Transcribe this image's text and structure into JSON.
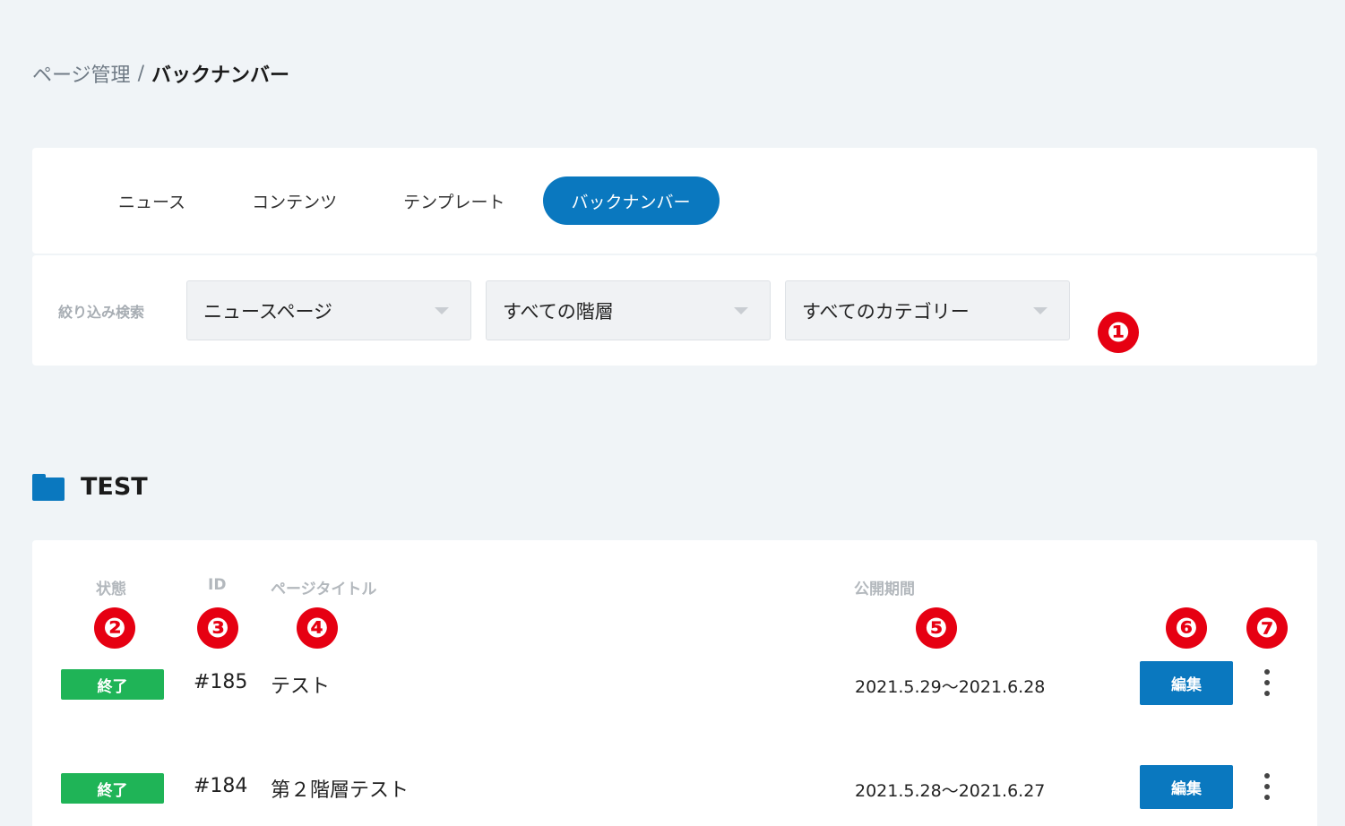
{
  "breadcrumb": {
    "parent": "ページ管理",
    "separator": "/",
    "current": "バックナンバー"
  },
  "tabs": [
    {
      "label": "ニュース",
      "active": false
    },
    {
      "label": "コンテンツ",
      "active": false
    },
    {
      "label": "テンプレート",
      "active": false
    },
    {
      "label": "バックナンバー",
      "active": true
    }
  ],
  "filter": {
    "label": "絞り込み検索",
    "selects": [
      {
        "value": "ニュースページ"
      },
      {
        "value": "すべての階層"
      },
      {
        "value": "すべてのカテゴリー"
      }
    ]
  },
  "markers": [
    "❶",
    "❷",
    "❸",
    "❹",
    "❺",
    "❻",
    "❼"
  ],
  "section": {
    "title": "TEST",
    "icon": "folder-icon"
  },
  "table": {
    "headers": {
      "status": "状態",
      "id": "ID",
      "title": "ページタイトル",
      "period": "公開期間"
    },
    "rows": [
      {
        "status": "終了",
        "id": "#185",
        "title": "テスト",
        "period": "2021.5.29～2021.6.28",
        "edit": "編集"
      },
      {
        "status": "終了",
        "id": "#184",
        "title": "第２階層テスト",
        "period": "2021.5.28～2021.6.27",
        "edit": "編集"
      }
    ]
  },
  "colors": {
    "accent": "#0a78bf",
    "status_done": "#1fb457",
    "marker": "#e60012",
    "background": "#f0f4f7"
  }
}
